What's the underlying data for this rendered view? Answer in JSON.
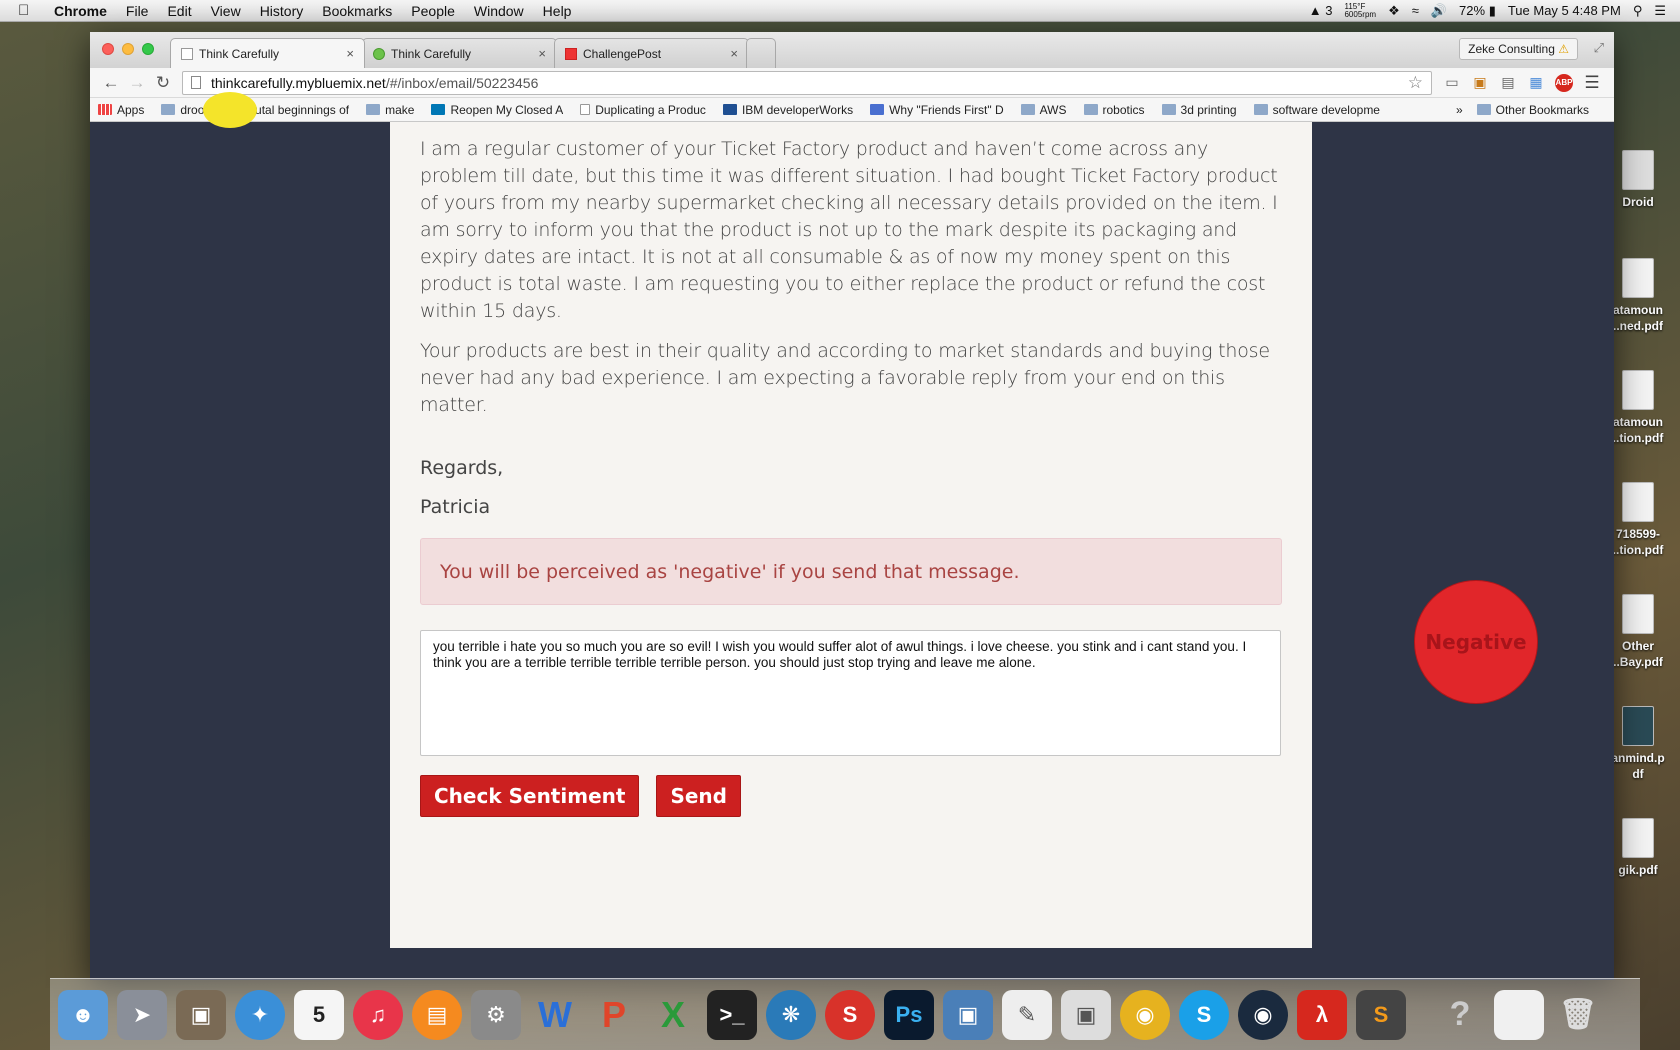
{
  "menubar": {
    "app": "Chrome",
    "items": [
      "File",
      "Edit",
      "View",
      "History",
      "Bookmarks",
      "People",
      "Window",
      "Help"
    ],
    "status": {
      "adobe_count": "3",
      "temp": "115°F",
      "rpm": "6005rpm",
      "battery": "72%",
      "datetime": "Tue May 5  4:48 PM"
    }
  },
  "desktop_icons": [
    "Droid",
    "atamoun\n..ned.pdf",
    "atamoun\n..tion.pdf",
    "718599-\n..tion.pdf",
    "Other\n..Bay.pdf",
    "anmind.p\ndf",
    "gik.pdf"
  ],
  "browser": {
    "tabs": [
      {
        "title": "Think Carefully",
        "active": true
      },
      {
        "title": "Think Carefully",
        "active": false
      },
      {
        "title": "ChallengePost",
        "active": false
      }
    ],
    "profile": "Zeke Consulting",
    "url_host": "thinkcarefully.mybluemix.net",
    "url_path": "/#/inbox/email/50223456",
    "bookmarks": [
      "Apps",
      "drool",
      "Brutal beginnings of",
      "make",
      "Reopen My Closed A",
      "Duplicating a Produc",
      "IBM developerWorks",
      "Why \"Friends First\" D",
      "AWS",
      "robotics",
      "3d printing",
      "software developme"
    ],
    "bookmarks_more": "»",
    "other_bookmarks": "Other Bookmarks"
  },
  "email": {
    "paragraph1": "I am a regular customer of your Ticket Factory product and haven’t come across any problem till date, but this time it was different situation. I had bought Ticket Factory product of yours from my nearby supermarket checking all necessary details provided on the item. I am sorry to inform you that the product is not up to the mark despite its packaging and expiry dates are intact. It is not at all consumable & as of now my money spent on this product is total waste. I am requesting you to either replace the product or refund the cost within 15 days.",
    "paragraph2": "Your products are best in their quality and according to market standards and buying those never had any bad experience. I am expecting a favorable reply from your end on this matter.",
    "closing": "Regards,",
    "signature": "Patricia"
  },
  "alert": {
    "message": "You will be perceived as 'negative' if you send that message."
  },
  "reply": {
    "value": "you terrible i hate you so much you are so evil! I wish you would suffer alot of awul things. i love cheese. you stink and i cant stand you. I think you are a terrible terrible terrible terrible person. you should just stop trying and leave me alone."
  },
  "buttons": {
    "check_sentiment": "Check Sentiment",
    "send": "Send"
  },
  "sentiment": {
    "label": "Negative",
    "color": "#e1262a"
  },
  "colors": {
    "accent": "#cc2020",
    "page_bg": "#2e3446",
    "alert_bg": "#f2dede",
    "alert_text": "#a94442"
  }
}
